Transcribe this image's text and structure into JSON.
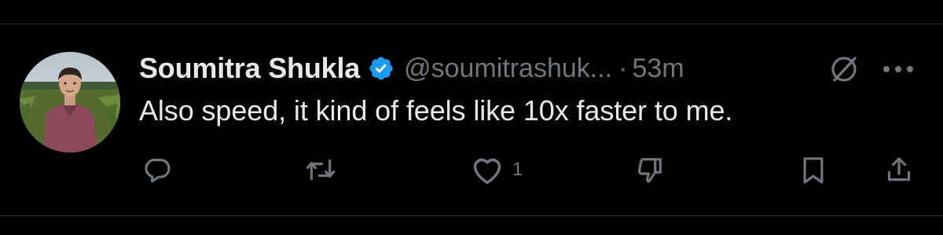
{
  "tweet": {
    "display_name": "Soumitra Shukla",
    "handle": "@soumitrashuk...",
    "separator": "·",
    "time": "53m",
    "text": "Also speed, it kind of feels like 10x faster to me.",
    "verified": true
  },
  "actions": {
    "reply_icon": "reply-icon",
    "retweet_icon": "retweet-icon",
    "like_icon": "heart-icon",
    "like_count": "1",
    "dislike_icon": "thumbs-down-icon",
    "bookmark_icon": "bookmark-icon",
    "share_icon": "share-icon"
  },
  "colors": {
    "background": "#000000",
    "text_primary": "#e7e9ea",
    "text_secondary": "#71767b",
    "verified_blue": "#1d9bf0",
    "divider": "#2f3336"
  }
}
